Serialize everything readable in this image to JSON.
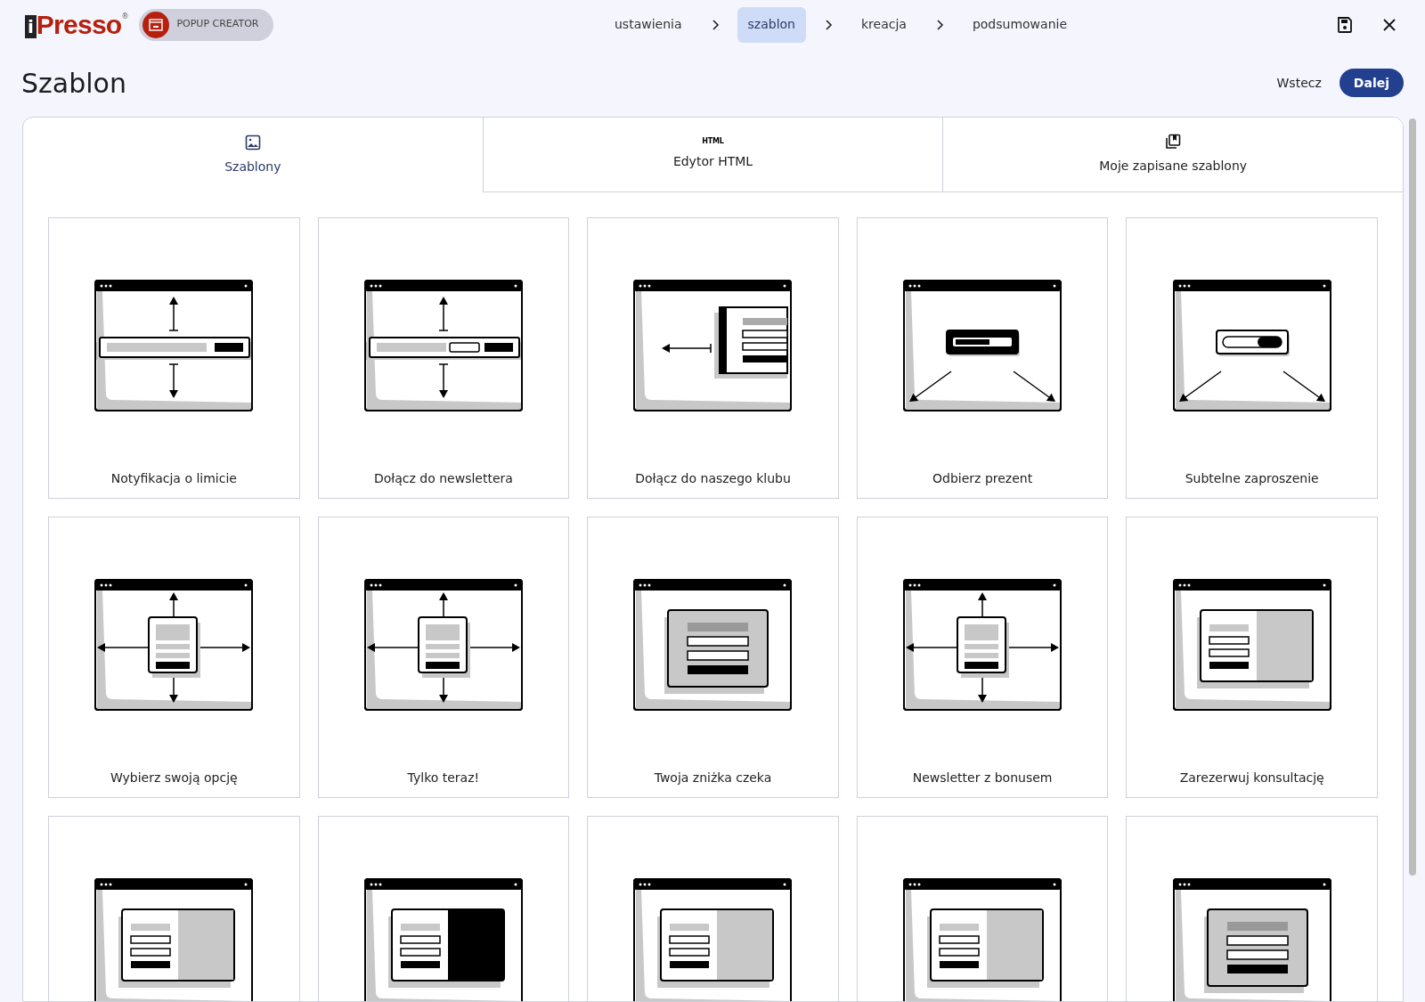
{
  "logo": {
    "mark": "i",
    "text": "Presso",
    "registered": "®"
  },
  "product_badge": {
    "label": "POPUP CREATOR"
  },
  "steps": [
    {
      "label": "ustawienia",
      "selected": false
    },
    {
      "label": "szablon",
      "selected": true
    },
    {
      "label": "kreacja",
      "selected": false
    },
    {
      "label": "podsumowanie",
      "selected": false
    }
  ],
  "page_title": "Szablon",
  "buttons": [
    {
      "label": "Wstecz",
      "kind": "text"
    },
    {
      "label": "Dalej",
      "kind": "primary"
    }
  ],
  "tabs": [
    {
      "label": "Szablony",
      "kind": "image",
      "selected": true
    },
    {
      "label": "Edytor HTML",
      "kind": "html",
      "icon_text": "HTML",
      "selected": false
    },
    {
      "label": "Moje zapisane szablony",
      "kind": "copy",
      "selected": false
    }
  ],
  "templates": [
    {
      "name": "Notyfikacja o limicie",
      "kind": "bar"
    },
    {
      "name": "Dołącz do newslettera",
      "kind": "bar-input"
    },
    {
      "name": "Dołącz do naszego klubu",
      "kind": "side-panel"
    },
    {
      "name": "Odbierz prezent",
      "kind": "banner"
    },
    {
      "name": "Subtelne zaproszenie",
      "kind": "toggle"
    },
    {
      "name": "Wybierz swoją opcję",
      "kind": "modal-arrows"
    },
    {
      "name": "Tylko teraz!",
      "kind": "modal-arrows"
    },
    {
      "name": "Twoja zniżka czeka",
      "kind": "modal"
    },
    {
      "name": "Newsletter z bonusem",
      "kind": "modal-arrows"
    },
    {
      "name": "Zarezerwuj konsultację",
      "kind": "split"
    },
    {
      "kind": "split"
    },
    {
      "kind": "split-dark"
    },
    {
      "kind": "split"
    },
    {
      "kind": "split"
    },
    {
      "kind": "modal"
    }
  ]
}
